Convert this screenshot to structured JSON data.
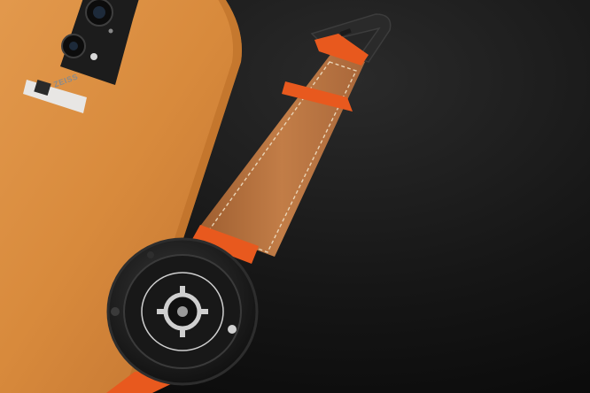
{
  "scene": {
    "colors": {
      "surface": "#141414",
      "phone_body": "#d88a3c",
      "phone_edge": "#b86c25",
      "camera_module": "#1c1c1c",
      "badge": "#e8e6e4",
      "strap_leather": "#b8733f",
      "strap_stitch": "#e9d4b6",
      "keeper_orange": "#e8591e",
      "buckle": "#2a2a2a",
      "watch_case": "#1e1e1e",
      "sensor_ring": "#cfcfcf"
    },
    "phone": {
      "badge_text": "ZEISS"
    }
  }
}
